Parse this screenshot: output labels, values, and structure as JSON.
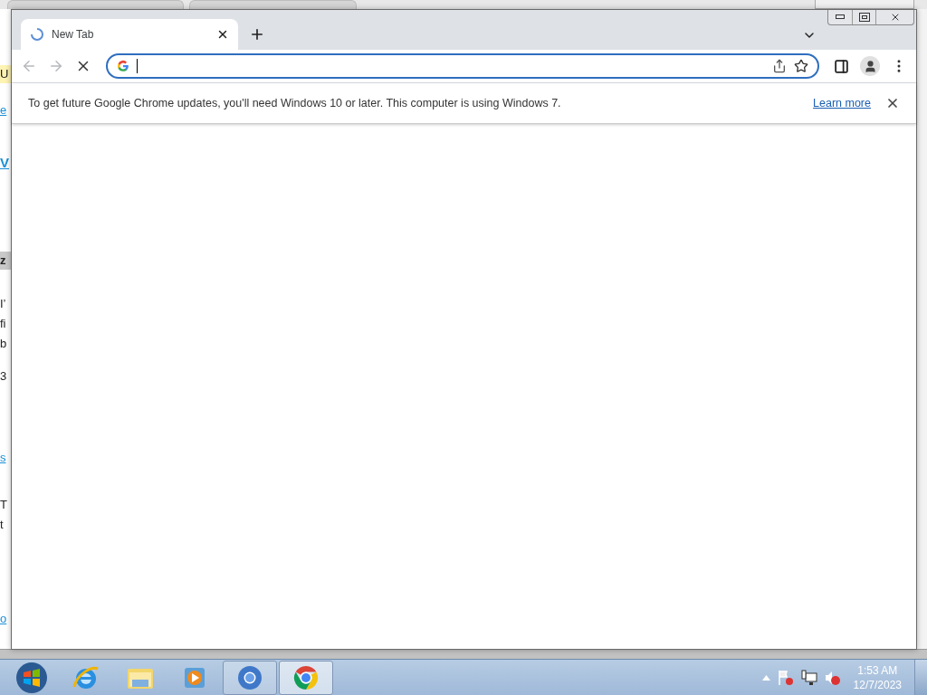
{
  "background_page": {
    "fragments": [
      {
        "text": "U",
        "kind": "banner"
      },
      {
        "text": "e",
        "kind": "link"
      },
      {
        "text": "V",
        "kind": "heading"
      },
      {
        "text": "z",
        "kind": "label"
      },
      {
        "text": "I’",
        "kind": "text"
      },
      {
        "text": "fi",
        "kind": "text"
      },
      {
        "text": "b",
        "kind": "text"
      },
      {
        "text": "3",
        "kind": "text"
      },
      {
        "text": "s",
        "kind": "link"
      },
      {
        "text": "T",
        "kind": "text"
      },
      {
        "text": "t",
        "kind": "text"
      },
      {
        "text": "o",
        "kind": "link"
      }
    ]
  },
  "browser": {
    "tabs": [
      {
        "title": "New Tab",
        "selected": true,
        "loading": true
      }
    ],
    "toolbar": {
      "back_disabled": true,
      "forward_disabled": true
    },
    "infobar": {
      "message": "To get future Google Chrome updates, you'll need Windows 10 or later. This computer is using Windows 7.",
      "link": "Learn more"
    }
  },
  "taskbar": {
    "items": [
      {
        "kind": "start",
        "running": false,
        "selected": false
      },
      {
        "kind": "ie",
        "running": false,
        "selected": false
      },
      {
        "kind": "explorer",
        "running": false,
        "selected": false
      },
      {
        "kind": "media",
        "running": false,
        "selected": false
      },
      {
        "kind": "chromium",
        "running": true,
        "selected": false
      },
      {
        "kind": "chrome",
        "running": true,
        "selected": true
      }
    ],
    "clock": {
      "time": "1:53 AM",
      "date": "12/7/2023"
    }
  }
}
